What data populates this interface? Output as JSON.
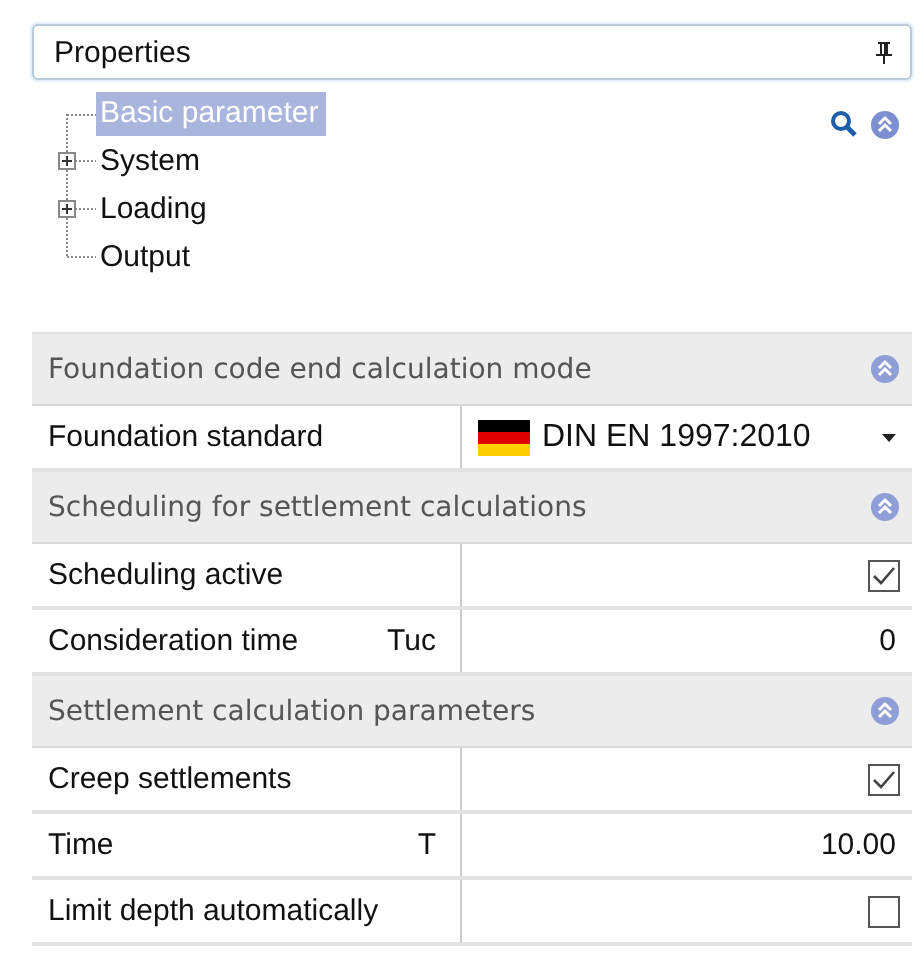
{
  "panel": {
    "title": "Properties"
  },
  "tree": [
    {
      "label": "Basic parameter",
      "kind": "leaf",
      "selected": true
    },
    {
      "label": "System",
      "kind": "group",
      "selected": false
    },
    {
      "label": "Loading",
      "kind": "group",
      "selected": false
    },
    {
      "label": "Output",
      "kind": "leaf",
      "selected": false
    }
  ],
  "sections": [
    {
      "title": "Foundation code end calculation mode",
      "rows": [
        {
          "label": "Foundation standard",
          "kind": "dropdown",
          "value": "DIN EN 1997:2010"
        }
      ]
    },
    {
      "title": "Scheduling for settlement calculations",
      "rows": [
        {
          "label": "Scheduling active",
          "kind": "checkbox",
          "checked": true
        },
        {
          "label": "Consideration time",
          "symbol": "Tuc",
          "kind": "number",
          "value": "0"
        }
      ]
    },
    {
      "title": "Settlement calculation parameters",
      "rows": [
        {
          "label": "Creep settlements",
          "kind": "checkbox",
          "checked": true
        },
        {
          "label": "Time",
          "symbol": "T",
          "kind": "number",
          "value": "10.00"
        },
        {
          "label": "Limit depth automatically",
          "kind": "checkbox",
          "checked": false
        }
      ]
    }
  ]
}
